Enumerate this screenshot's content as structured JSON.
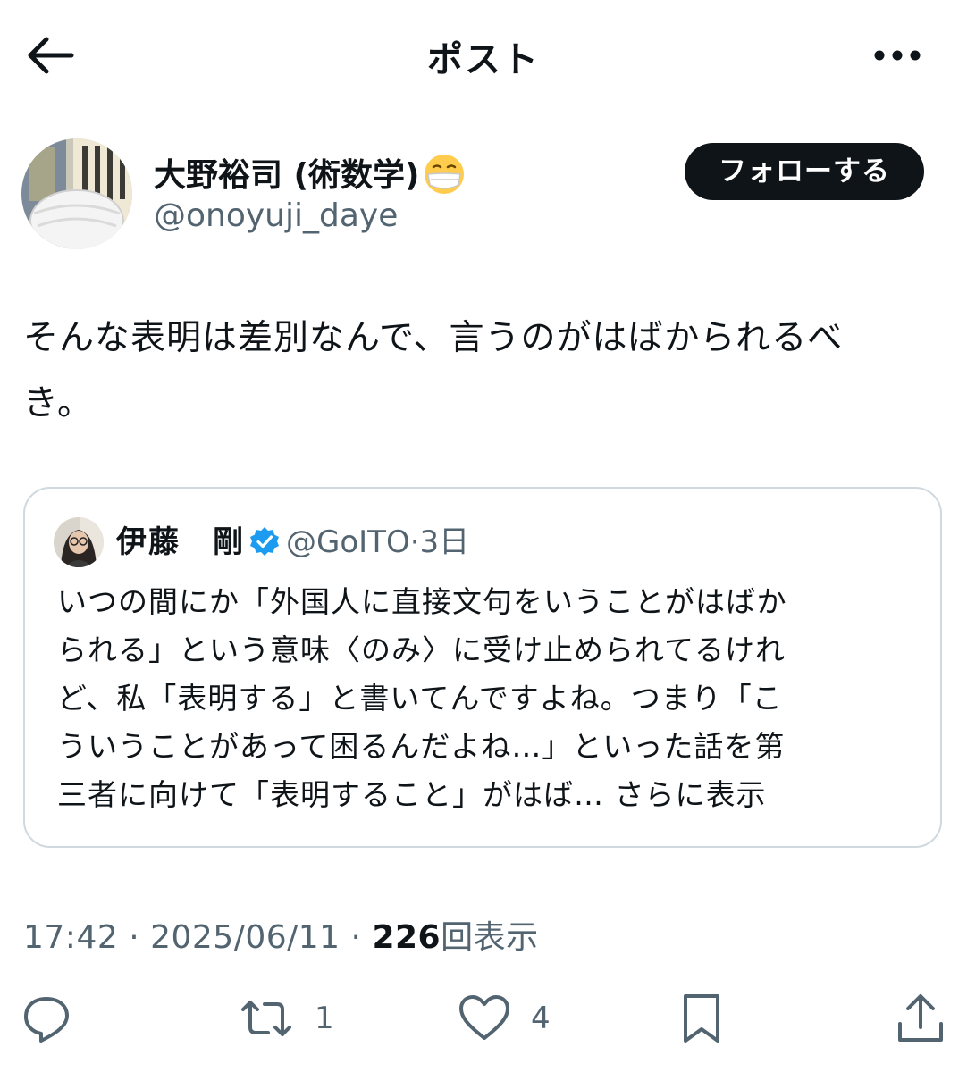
{
  "header": {
    "title": "ポスト",
    "back_icon": "arrow-left-icon",
    "more_icon": "more-horizontal-icon"
  },
  "author": {
    "display_name": "大野裕司 (術数学)",
    "emoji": "face-with-medical-mask",
    "handle": "@onoyuji_daye",
    "follow_label": "フォローする"
  },
  "tweet": {
    "line1": "そんな表明は差別なんで、言うのがはばかられるべ",
    "line2": "き。"
  },
  "quote": {
    "name": "伊藤　剛",
    "verified": true,
    "handle": "@GoITO",
    "separator": "·",
    "time": "3日",
    "lines": [
      "いつの間にか「外国人に直接文句をいうことがはばか",
      "られる」という意味〈のみ〉に受け止められてるけれ",
      "ど、私「表明する」と書いてんですよね。つまり「こ",
      "ういうことがあって困るんだよね…」といった話を第",
      "三者に向けて「表明すること」がはば… "
    ],
    "show_more": "さらに表示"
  },
  "meta": {
    "time": "17:42",
    "dot1": " · ",
    "date": "2025/06/11",
    "dot2": " · ",
    "views": "226",
    "views_label": "回表示"
  },
  "actions": {
    "reply_count": "",
    "retweet_count": "1",
    "like_count": "4"
  },
  "colors": {
    "text": "#0f1419",
    "secondary": "#536471",
    "border": "#cfd9de",
    "verified": "#1d9bf0",
    "follow_bg": "#0f1419"
  }
}
